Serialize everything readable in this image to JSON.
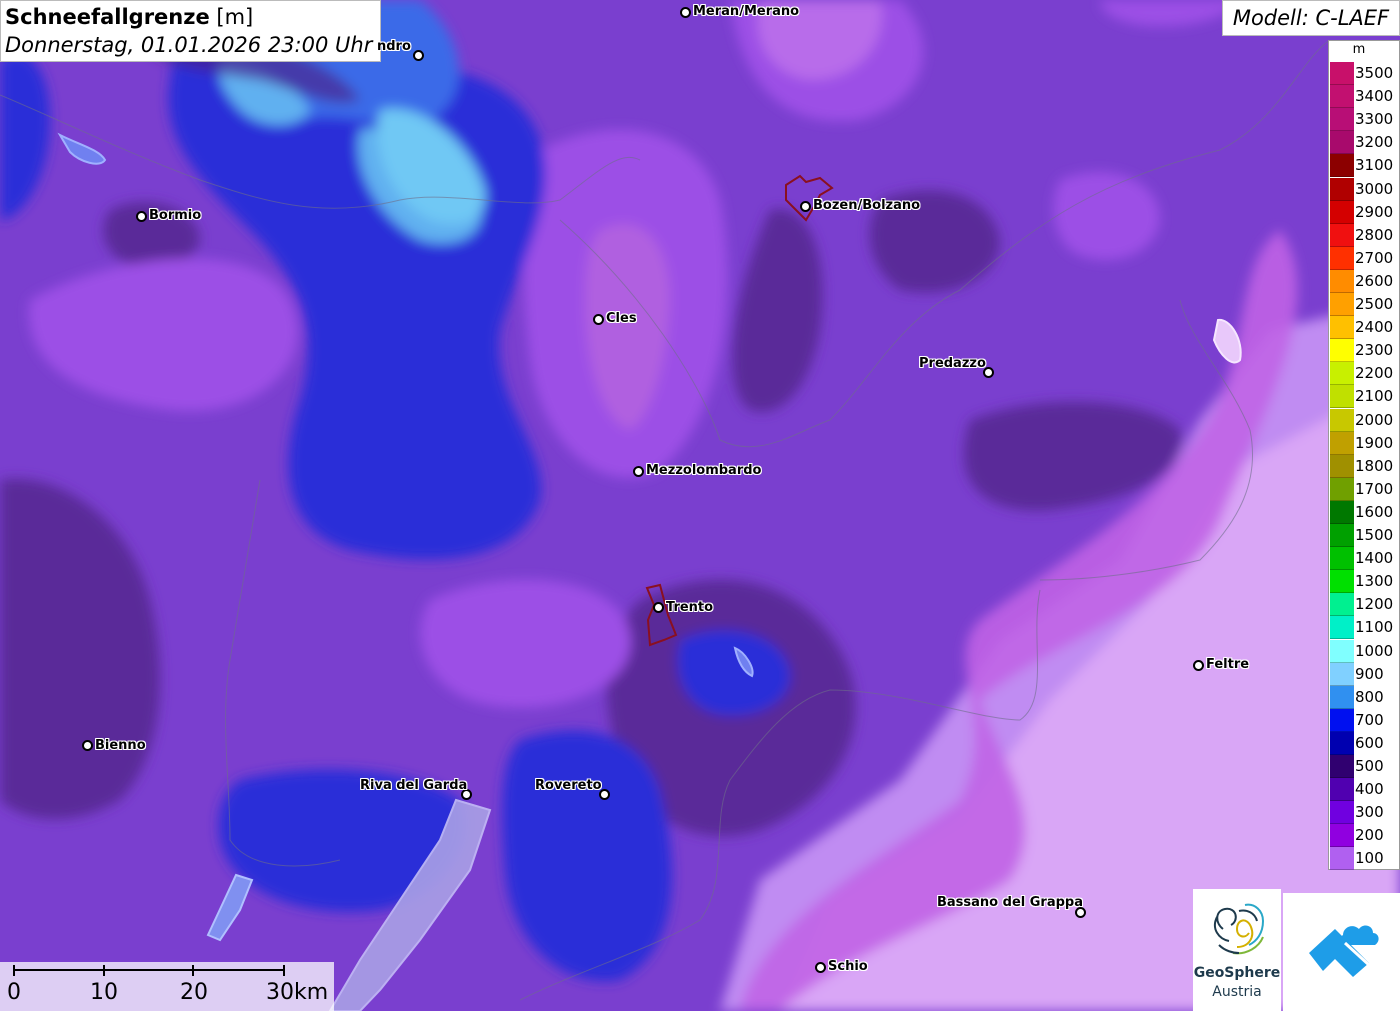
{
  "header": {
    "title_bold": "Schneefallgrenze",
    "title_unit": "[m]",
    "datetime": "Donnerstag, 01.01.2026 23:00 Uhr",
    "model": "Modell: C-LAEF"
  },
  "legend": {
    "unit": "m",
    "steps": [
      {
        "label": "3500",
        "color": "#c8106a"
      },
      {
        "label": "3400",
        "color": "#c21070"
      },
      {
        "label": "3300",
        "color": "#b80e76"
      },
      {
        "label": "3200",
        "color": "#a80a6c"
      },
      {
        "label": "3100",
        "color": "#8c0000"
      },
      {
        "label": "3000",
        "color": "#b00000"
      },
      {
        "label": "2900",
        "color": "#d40000"
      },
      {
        "label": "2800",
        "color": "#f01010"
      },
      {
        "label": "2700",
        "color": "#ff3000"
      },
      {
        "label": "2600",
        "color": "#ff8c00"
      },
      {
        "label": "2500",
        "color": "#ffa000"
      },
      {
        "label": "2400",
        "color": "#ffc000"
      },
      {
        "label": "2300",
        "color": "#ffff00"
      },
      {
        "label": "2200",
        "color": "#c8f000"
      },
      {
        "label": "2100",
        "color": "#c0e000"
      },
      {
        "label": "2000",
        "color": "#c8c800"
      },
      {
        "label": "1900",
        "color": "#c0a000"
      },
      {
        "label": "1800",
        "color": "#a09000"
      },
      {
        "label": "1700",
        "color": "#70a000"
      },
      {
        "label": "1600",
        "color": "#007800"
      },
      {
        "label": "1500",
        "color": "#00a000"
      },
      {
        "label": "1400",
        "color": "#00c000"
      },
      {
        "label": "1300",
        "color": "#00e000"
      },
      {
        "label": "1200",
        "color": "#00f090"
      },
      {
        "label": "1100",
        "color": "#00f0c8"
      },
      {
        "label": "1000",
        "color": "#80ffff"
      },
      {
        "label": "900",
        "color": "#80d0ff"
      },
      {
        "label": "800",
        "color": "#3090f0"
      },
      {
        "label": "700",
        "color": "#0010f0"
      },
      {
        "label": "600",
        "color": "#0000b0"
      },
      {
        "label": "500",
        "color": "#300070"
      },
      {
        "label": "400",
        "color": "#5000b0"
      },
      {
        "label": "300",
        "color": "#7000e0"
      },
      {
        "label": "200",
        "color": "#9000e0"
      },
      {
        "label": "100",
        "color": "#b060f0"
      }
    ]
  },
  "cities": [
    {
      "name": "Meran/Merano",
      "icon": "city-dot"
    },
    {
      "name": "ndro",
      "icon": "city-dot"
    },
    {
      "name": "Bormio",
      "icon": "city-dot"
    },
    {
      "name": "Bozen/Bolzano",
      "icon": "city-dot"
    },
    {
      "name": "Cles",
      "icon": "city-dot"
    },
    {
      "name": "Predazzo",
      "icon": "city-dot"
    },
    {
      "name": "Mezzolombardo",
      "icon": "city-dot"
    },
    {
      "name": "Trento",
      "icon": "city-dot"
    },
    {
      "name": "Feltre",
      "icon": "city-dot"
    },
    {
      "name": "Bienno",
      "icon": "city-dot"
    },
    {
      "name": "Riva del Garda",
      "icon": "city-dot"
    },
    {
      "name": "Rovereto",
      "icon": "city-dot"
    },
    {
      "name": "Bassano del Grappa",
      "icon": "city-dot"
    },
    {
      "name": "Schio",
      "icon": "city-dot"
    }
  ],
  "scale_bar": {
    "labels": [
      "0",
      "10",
      "20",
      "30km"
    ]
  },
  "logos": {
    "geosphere_line1": "GeoSphere",
    "geosphere_line2": "Austria"
  }
}
